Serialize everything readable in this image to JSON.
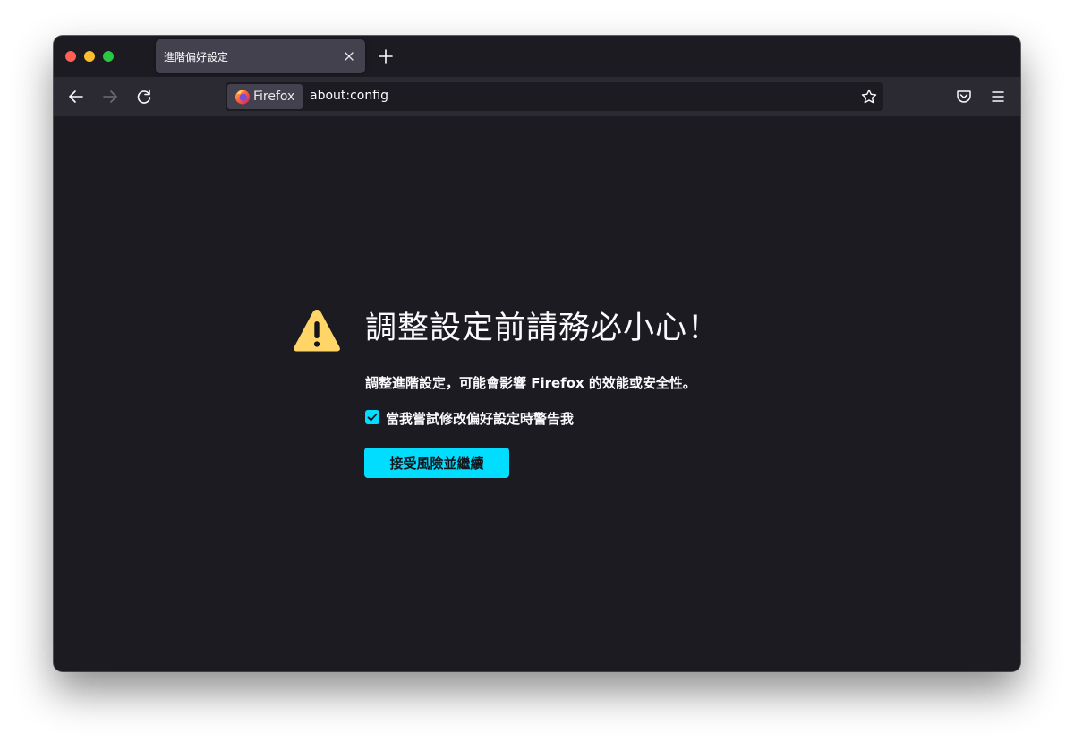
{
  "tab": {
    "title": "進階偏好設定"
  },
  "urlbar": {
    "identity_label": "Firefox",
    "url": "about:config"
  },
  "warning": {
    "heading": "調整設定前請務必小心！",
    "description": "調整進階設定，可能會影響 Firefox 的效能或安全性。",
    "checkbox_label": "當我嘗試修改偏好設定時警告我",
    "checkbox_checked": true,
    "accept_button": "接受風險並繼續"
  },
  "colors": {
    "accent": "#00ddff",
    "warning": "#ffd567",
    "background": "#1c1b22",
    "toolbar": "#2b2a33"
  },
  "icons": {
    "back": "arrow-left-icon",
    "forward": "arrow-right-icon",
    "reload": "reload-icon",
    "bookmark": "star-icon",
    "pocket": "pocket-icon",
    "menu": "hamburger-menu-icon",
    "warning": "warning-triangle-icon"
  }
}
